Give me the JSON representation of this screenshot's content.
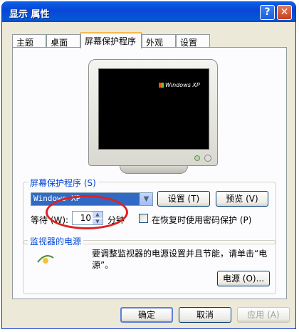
{
  "window": {
    "title": "显示 属性",
    "help_glyph": "?",
    "close_glyph": "✕"
  },
  "tabs": [
    {
      "label": "主题"
    },
    {
      "label": "桌面"
    },
    {
      "label": "屏幕保护程序"
    },
    {
      "label": "外观"
    },
    {
      "label": "设置"
    }
  ],
  "preview": {
    "screen_logo": "Windows XP"
  },
  "screensaver": {
    "group_label": "屏幕保护程序 (S)",
    "selected": "Windows XP",
    "settings_label": "设置 (T)",
    "preview_label": "预览 (V)",
    "wait_label": "等待 (W):",
    "wait_value": "10",
    "minutes_label": "分钟",
    "password_checkbox_label": "在恢复时使用密码保护 (P)",
    "password_checked": false
  },
  "power": {
    "group_label": "监视器的电源",
    "description": "要调整监视器的电源设置并且节能，请单击“电源”。",
    "button_label": "电源 (O)..."
  },
  "footer": {
    "ok_label": "确定",
    "cancel_label": "取消",
    "apply_label": "应用 (A)"
  },
  "colors": {
    "titlebar": "#0a5fe8",
    "highlight_circle": "#dd2222",
    "group_label": "#0046d5"
  }
}
